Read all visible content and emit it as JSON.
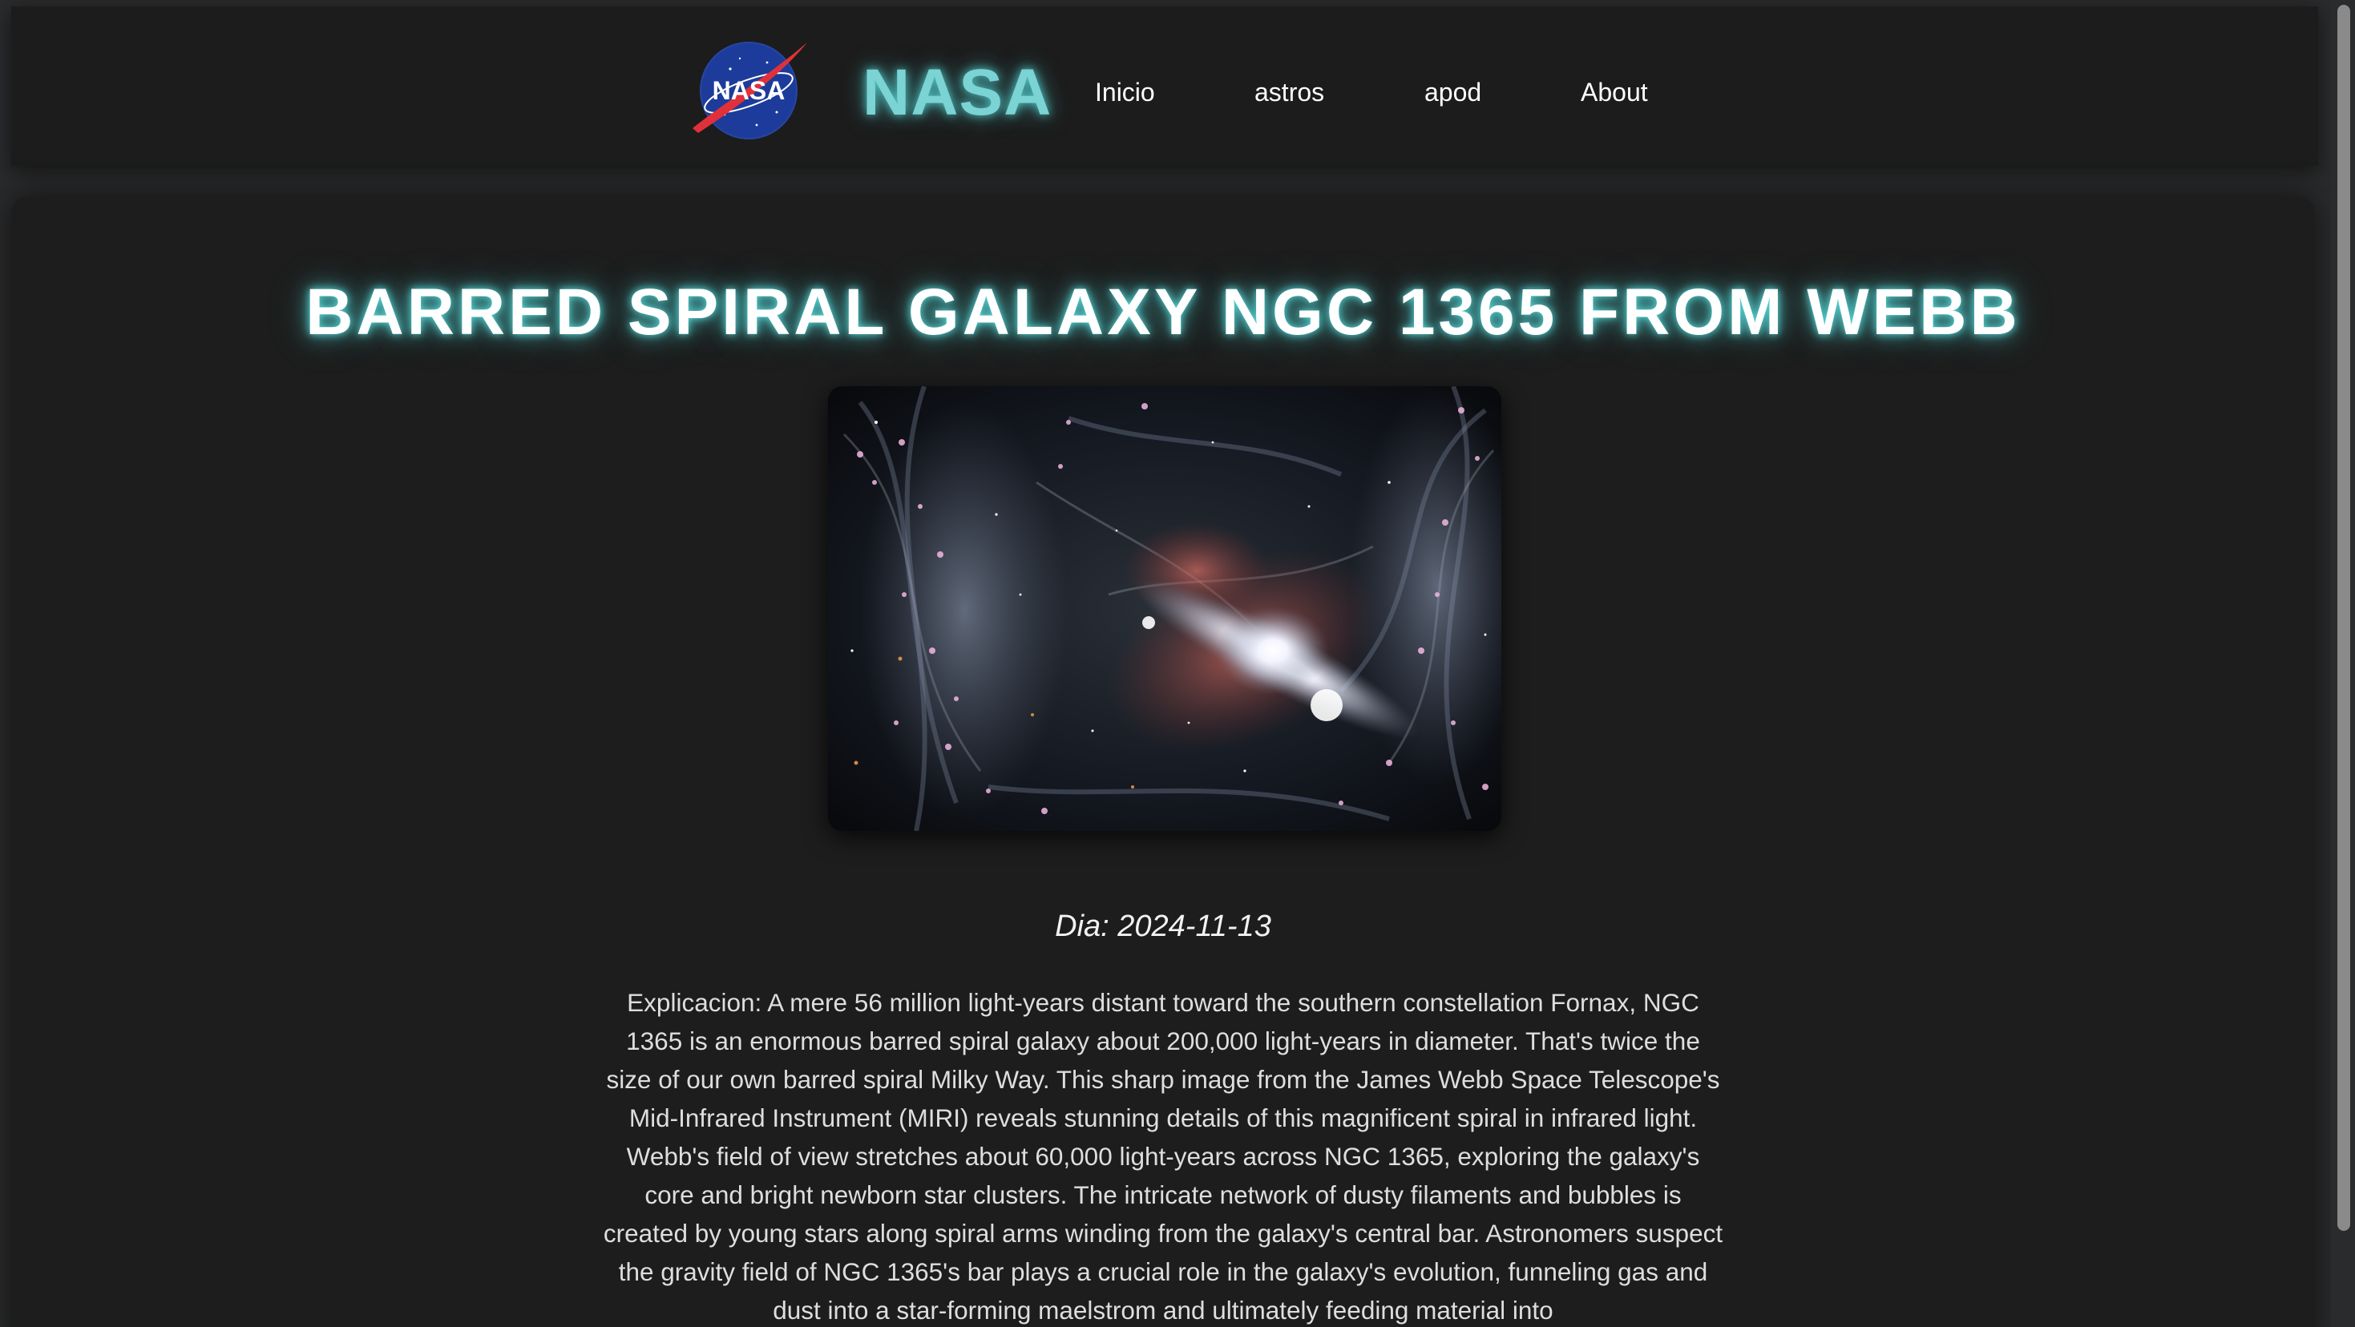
{
  "header": {
    "logo_text": "NASA",
    "brand": "NASA",
    "nav": [
      {
        "label": "Inicio"
      },
      {
        "label": "astros"
      },
      {
        "label": "apod"
      },
      {
        "label": "About"
      }
    ]
  },
  "apod": {
    "title": "BARRED SPIRAL GALAXY NGC 1365 FROM WEBB",
    "image_subject": "galaxy-image",
    "date_label": "Dia: 2024-11-13",
    "explanation": "Explicacion: A mere 56 million light-years distant toward the southern constellation Fornax, NGC 1365 is an enormous barred spiral galaxy about 200,000 light-years in diameter. That's twice the size of our own barred spiral Milky Way. This sharp image from the James Webb Space Telescope's Mid-Infrared Instrument (MIRI) reveals stunning details of this magnificent spiral in infrared light. Webb's field of view stretches about 60,000 light-years across NGC 1365, exploring the galaxy's core and bright newborn star clusters. The intricate network of dusty filaments and bubbles is created by young stars along spiral arms winding from the galaxy's central bar. Astronomers suspect the gravity field of NGC 1365's bar plays a crucial role in the galaxy's evolution, funneling gas and dust into a star-forming maelstrom and ultimately feeding material into"
  },
  "colors": {
    "page_bg": "#2a2b2c",
    "header_bg": "#1c1c1c",
    "card_bg": "#1d1d1d",
    "glow_cyan": "#5ae6e6",
    "brand_text": "#7bd3d3"
  }
}
